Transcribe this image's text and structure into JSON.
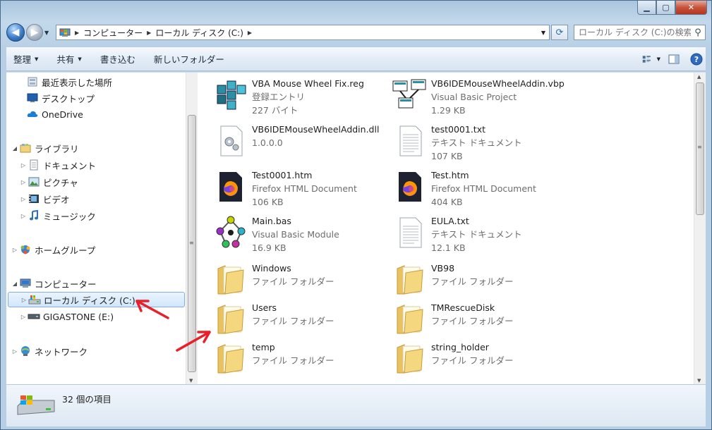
{
  "address": {
    "segments": [
      "コンピューター",
      "ローカル ディスク (C:)"
    ]
  },
  "search": {
    "placeholder": "ローカル ディスク (C:)の検索"
  },
  "toolbar": {
    "organize": "整理",
    "share": "共有",
    "burn": "書き込む",
    "new_folder": "新しいフォルダー"
  },
  "nav": {
    "recent": "最近表示した場所",
    "desktop": "デスクトップ",
    "onedrive": "OneDrive",
    "libraries": "ライブラリ",
    "documents": "ドキュメント",
    "pictures": "ピクチャ",
    "videos": "ビデオ",
    "music": "ミュージック",
    "homegroup": "ホームグループ",
    "computer": "コンピューター",
    "local_disk": "ローカル ディスク (C:)",
    "gigastone": "GIGASTONE (E:)",
    "network": "ネットワーク"
  },
  "files": [
    {
      "name": "VBA Mouse Wheel Fix.reg",
      "type": "登録エントリ",
      "size": "227 バイト",
      "icon": "registry-icon"
    },
    {
      "name": "VB6IDEMouseWheelAddin.vbp",
      "type": "Visual Basic Project",
      "size": "1.29 KB",
      "icon": "vb-project-icon"
    },
    {
      "name": "VB6IDEMouseWheelAddin.dll",
      "type": "1.0.0.0",
      "size": "",
      "icon": "dll-icon"
    },
    {
      "name": "test0001.txt",
      "type": "テキスト ドキュメント",
      "size": "107 KB",
      "icon": "text-file-icon"
    },
    {
      "name": "Test0001.htm",
      "type": "Firefox HTML Document",
      "size": "106 KB",
      "icon": "firefox-doc-icon"
    },
    {
      "name": "Test.htm",
      "type": "Firefox HTML Document",
      "size": "404 KB",
      "icon": "firefox-doc-icon"
    },
    {
      "name": "Main.bas",
      "type": "Visual Basic Module",
      "size": "16.9 KB",
      "icon": "vb-module-icon"
    },
    {
      "name": "EULA.txt",
      "type": "テキスト ドキュメント",
      "size": "12.1 KB",
      "icon": "text-file-icon"
    },
    {
      "name": "Windows",
      "type": "ファイル フォルダー",
      "size": "",
      "icon": "folder-icon"
    },
    {
      "name": "VB98",
      "type": "ファイル フォルダー",
      "size": "",
      "icon": "folder-icon"
    },
    {
      "name": "Users",
      "type": "ファイル フォルダー",
      "size": "",
      "icon": "folder-icon"
    },
    {
      "name": "TMRescueDisk",
      "type": "ファイル フォルダー",
      "size": "",
      "icon": "folder-icon"
    },
    {
      "name": "temp",
      "type": "ファイル フォルダー",
      "size": "",
      "icon": "folder-icon"
    },
    {
      "name": "string_holder",
      "type": "ファイル フォルダー",
      "size": "",
      "icon": "folder-icon"
    }
  ],
  "status": {
    "count": "32 個の項目"
  },
  "colors": {
    "annotation_arrow": "#e8202a",
    "selection": "#d2e7fb",
    "folder": "#f3d27a"
  }
}
